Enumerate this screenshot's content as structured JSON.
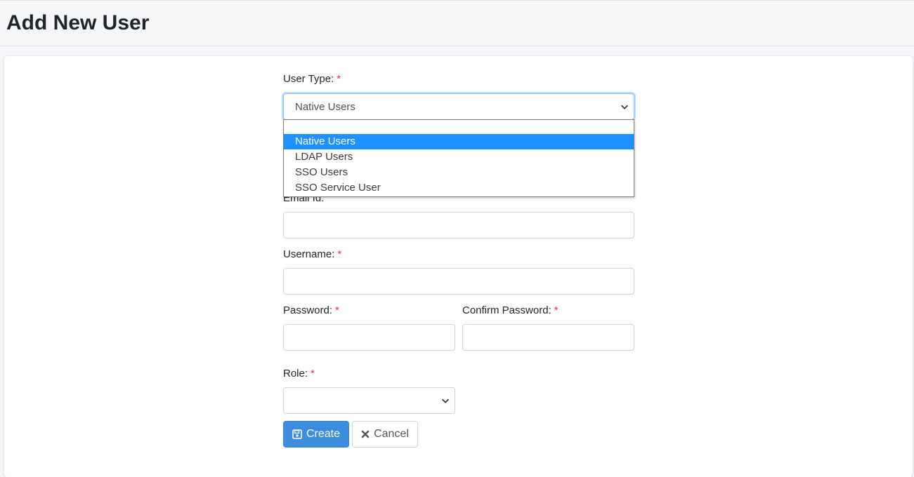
{
  "header": {
    "title": "Add New User"
  },
  "form": {
    "user_type": {
      "label": "User Type:",
      "required_mark": "*",
      "selected": "Native Users",
      "options": [
        "",
        "Native Users",
        "LDAP Users",
        "SSO Users",
        "SSO Service User"
      ]
    },
    "email": {
      "label": "Email Id:",
      "value": ""
    },
    "username": {
      "label": "Username:",
      "required_mark": "*",
      "value": ""
    },
    "password": {
      "label": "Password:",
      "required_mark": "*",
      "value": ""
    },
    "confirm_password": {
      "label": "Confirm Password:",
      "required_mark": "*",
      "value": ""
    },
    "role": {
      "label": "Role:",
      "required_mark": "*",
      "selected": ""
    }
  },
  "buttons": {
    "create_label": "Create",
    "cancel_label": "Cancel"
  },
  "icons": {
    "create": "floppy-disk-icon",
    "cancel": "x-mark-icon",
    "select_arrow": "chevron-down-icon"
  },
  "colors": {
    "primary": "#3c8dde",
    "required": "#dc3545",
    "highlight": "#1e90ff"
  }
}
